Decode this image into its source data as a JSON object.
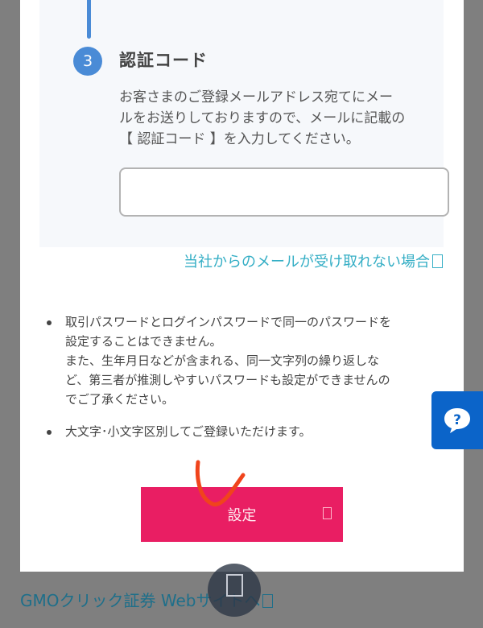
{
  "step": {
    "number": "3",
    "title": "認証コード",
    "description_lines": [
      "お客さまのご登録メールアドレス宛てにメー",
      "ルをお送りしておりますので、メールに記載の",
      "【 認証コード 】を入力してください。"
    ],
    "code_input_value": ""
  },
  "help_link": "当社からのメールが受け取れない場合",
  "notes": [
    {
      "lines": [
        "取引パスワードとログインパスワードで同一のパスワードを",
        "設定することはできません。",
        "また、生年月日などが含まれる、同一文字列の繰り返しな",
        "ど、第三者が推測しやすいパスワードも設定ができませんの",
        "でご了承ください。"
      ]
    },
    {
      "lines": [
        "大文字･小文字区別してご登録いただけます。"
      ]
    }
  ],
  "submit_label": "設定",
  "bottom_link": "GMOクリック証券 Webサイトへ",
  "colors": {
    "accent_blue": "#4a8bd6",
    "link_teal": "#34aec5",
    "button_pink": "#e91e63",
    "fab_blue": "#0b64c9"
  },
  "icons": {
    "help_fab": "question-bubble-icon",
    "scroll_top": "scroll-top-icon",
    "external_link": "external-link-icon"
  }
}
